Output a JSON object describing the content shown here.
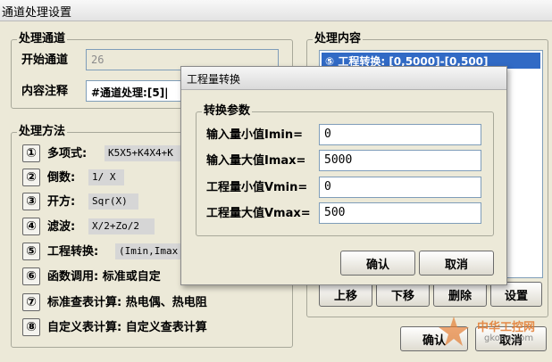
{
  "window": {
    "title": "通道处理设置"
  },
  "processing_channel": {
    "group_title": "处理通道",
    "start_label": "开始通道",
    "start_value": "26",
    "comment_label": "内容注释",
    "comment_value": "#通道处理:[5]|"
  },
  "methods": {
    "group_title": "处理方法",
    "items": [
      {
        "num": "①",
        "label": "多项式:",
        "formula": "K5X5+K4X4+K"
      },
      {
        "num": "②",
        "label": "倒数:",
        "formula": "1/ X"
      },
      {
        "num": "③",
        "label": "开方:",
        "formula": "Sqr(X)"
      },
      {
        "num": "④",
        "label": "滤波:",
        "formula": "X/2+Zo/2"
      },
      {
        "num": "⑤",
        "label": "工程转换:",
        "formula": "(Imin,Imax"
      },
      {
        "num": "⑥",
        "label": "函数调用: 标准或自定"
      },
      {
        "num": "⑦",
        "label": "标准查表计算: 热电偶、热电阻"
      },
      {
        "num": "⑧",
        "label": "自定义表计算: 自定义查表计算"
      }
    ]
  },
  "content": {
    "group_title": "处理内容",
    "list_items": [
      "⑤ 工程转换: [0,5000]-[0,500]"
    ],
    "buttons": {
      "up": "上移",
      "down": "下移",
      "delete": "删除",
      "settings": "设置"
    }
  },
  "main_buttons": {
    "ok": "确认",
    "cancel": "取消"
  },
  "dialog": {
    "title": "工程量转换",
    "group_title": "转换参数",
    "fields": [
      {
        "label": "输入量小值Imin=",
        "value": "0"
      },
      {
        "label": "输入量大值Imax=",
        "value": "5000"
      },
      {
        "label": "工程量小值Vmin=",
        "value": "0"
      },
      {
        "label": "工程量大值Vmax=",
        "value": "500"
      }
    ],
    "ok": "确认",
    "cancel": "取消"
  },
  "watermark": {
    "text": "中华工控网",
    "sub": "gkong.com"
  },
  "colors": {
    "selection": "#316ac5",
    "watermark": "#e37a2e"
  }
}
